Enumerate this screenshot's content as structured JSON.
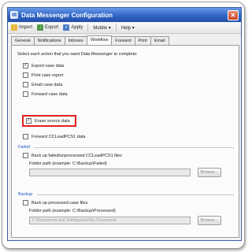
{
  "window": {
    "title": "Data Messenger Configuration",
    "close_glyph": "✕"
  },
  "toolbar": {
    "import_label": "Import",
    "export_label": "Export",
    "apply_label": "Apply",
    "mobile_label": "Mobile ▾",
    "help_label": "Help ▾"
  },
  "tabs": [
    {
      "label": "General"
    },
    {
      "label": "Notifications"
    },
    {
      "label": "Inboxes"
    },
    {
      "label": "Workflow"
    },
    {
      "label": "Forward"
    },
    {
      "label": "Print"
    },
    {
      "label": "Email"
    }
  ],
  "active_tab": "Workflow",
  "panel": {
    "instruction": "Select each action that you want Data Messenger to complete:",
    "actions": [
      {
        "label": "Export case data",
        "checked": true
      },
      {
        "label": "Print case report",
        "checked": false
      },
      {
        "label": "Email case data",
        "checked": false
      },
      {
        "label": "Forward case data",
        "checked": false
      },
      {
        "label": "Erase source data",
        "checked": true
      },
      {
        "label": "Forward CCLeadPCS1 data",
        "checked": false
      }
    ],
    "failed": {
      "group_label": "Failed",
      "checkbox_label": "Back up failed/unprocessed CCLeadPCS1 files",
      "folder_label": "Folder path (example: C:\\Backup\\Failed)",
      "path_value": "",
      "browse_label": "Browse..."
    },
    "backup": {
      "group_label": "Backup",
      "checkbox_label": "Back up processed case files",
      "folder_label": "Folder path (example: C:\\Backup\\Processed)",
      "path_value": "C:\\Documents and Settings\\user\\My Documents",
      "browse_label": "Browse..."
    }
  },
  "colors": {
    "title_bar": "#2f64c6",
    "highlight": "#e02020",
    "group_label": "#1e50c8"
  }
}
